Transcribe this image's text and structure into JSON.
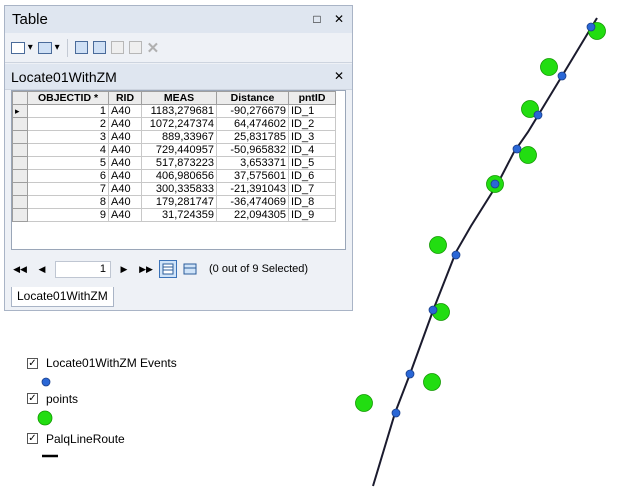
{
  "window": {
    "title": "Table"
  },
  "table_tab": {
    "title": "Locate01WithZM"
  },
  "columns": [
    "OBJECTID *",
    "RID",
    "MEAS",
    "Distance",
    "pntID"
  ],
  "rows": [
    [
      "1",
      "A40",
      "1183,279681",
      "-90,276679",
      "ID_1"
    ],
    [
      "2",
      "A40",
      "1072,247374",
      "64,474602",
      "ID_2"
    ],
    [
      "3",
      "A40",
      "889,33967",
      "25,831785",
      "ID_3"
    ],
    [
      "4",
      "A40",
      "729,440957",
      "-50,965832",
      "ID_4"
    ],
    [
      "5",
      "A40",
      "517,873223",
      "3,653371",
      "ID_5"
    ],
    [
      "6",
      "A40",
      "406,980656",
      "37,575601",
      "ID_6"
    ],
    [
      "7",
      "A40",
      "300,335833",
      "-21,391043",
      "ID_7"
    ],
    [
      "8",
      "A40",
      "179,281747",
      "-36,474069",
      "ID_8"
    ],
    [
      "9",
      "A40",
      "31,724359",
      "22,094305",
      "ID_9"
    ]
  ],
  "navigator": {
    "current_record": "1",
    "selection_status": "(0 out of 9 Selected)"
  },
  "bottom_tab": {
    "label": "Locate01WithZM"
  },
  "legend": [
    {
      "label": "Locate01WithZM Events",
      "symbol": "small-blue-point",
      "color": "#2a67d6",
      "checked": true
    },
    {
      "label": "points",
      "symbol": "large-green-point",
      "color": "#22dd11",
      "checked": true
    },
    {
      "label": "PalqLineRoute",
      "symbol": "black-line",
      "color": "#000000",
      "checked": true
    }
  ],
  "colors": {
    "route_line": "#1b1b2e",
    "event_point": "#2a67d6",
    "source_point": "#22dd11"
  }
}
